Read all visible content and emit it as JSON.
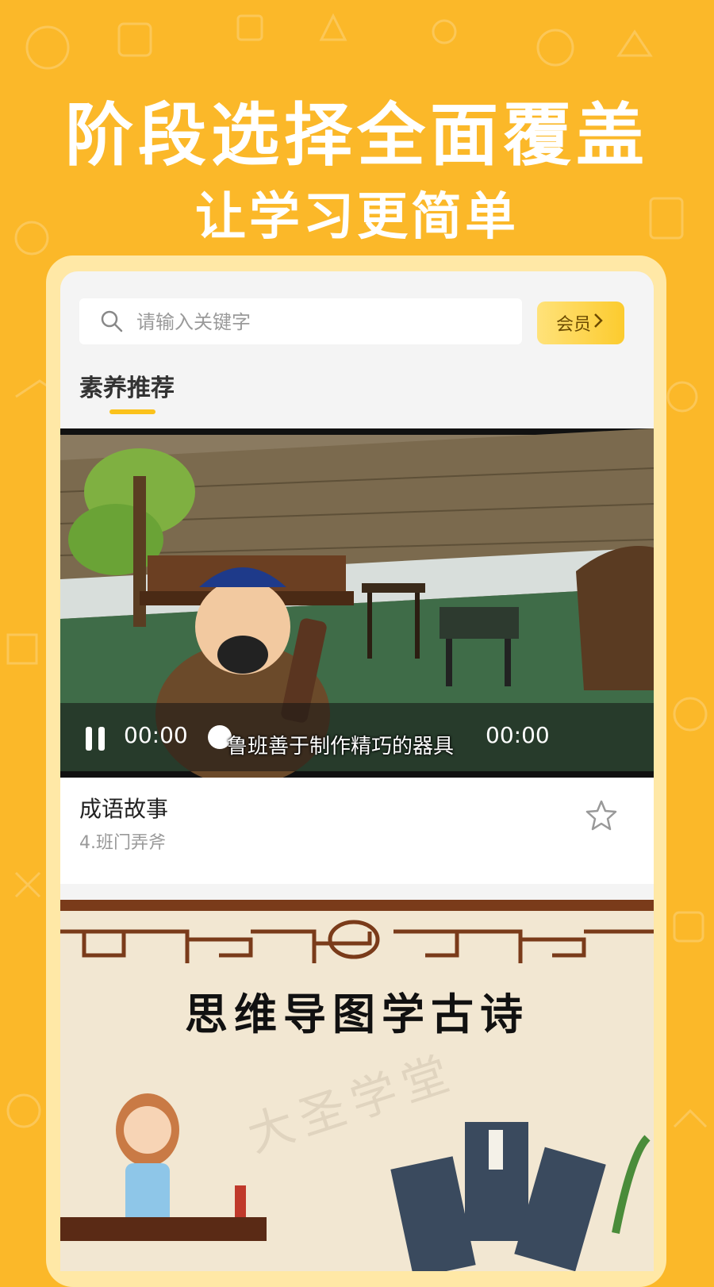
{
  "header": {
    "headline": "阶段选择全面覆盖",
    "subline": "让学习更简单"
  },
  "search": {
    "placeholder": "请输入关键字",
    "icon": "search-icon"
  },
  "member_button": {
    "label": "会员",
    "icon": "chevron-right-icon"
  },
  "section": {
    "title": "素养推荐"
  },
  "video": {
    "current_time": "00:00",
    "total_time": "00:00",
    "subtitle": "鲁班善于制作精巧的器具",
    "state": "playing"
  },
  "card": {
    "title": "成语故事",
    "subtitle": "4.班门弄斧",
    "favorite_icon": "star-outline-icon"
  },
  "banner": {
    "title": "思维导图学古诗",
    "watermark": "大圣学堂"
  },
  "colors": {
    "background": "#FBB829",
    "accent": "#FBC21B"
  }
}
